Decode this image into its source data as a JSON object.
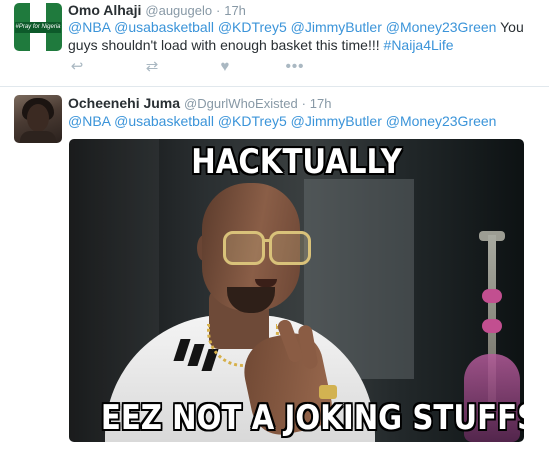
{
  "tweets": [
    {
      "fullname": "Omo Alhaji",
      "username": "@augugelo",
      "separator": "·",
      "time": "17h",
      "avatar_text": "#Pray for Nigeria",
      "mentions": "@NBA @usabasketball @KDTrey5 @JimmyButler @Money23Green",
      "text": " You guys shouldn't load with enough basket this time!!! ",
      "hashtag": "#Naija4Life",
      "actions": [
        "reply-icon",
        "retweet-icon",
        "like-icon",
        "more-icon"
      ]
    },
    {
      "fullname": "Ocheenehi Juma",
      "username": "@DgurlWhoExisted",
      "separator": "·",
      "time": "17h",
      "mentions": "@NBA @usabasketball @KDTrey5 @JimmyButler @Money23Green",
      "meme_top": "HACKTUALLY",
      "meme_bottom": "EEZ NOT A JOKING STUFFS"
    }
  ],
  "icons": {
    "reply": "↩",
    "retweet": "⇄",
    "like": "♥",
    "more": "•••"
  },
  "colors": {
    "link": "#3b94d9",
    "muted": "#8899a6",
    "text": "#292f33",
    "action": "#aab8c2"
  }
}
